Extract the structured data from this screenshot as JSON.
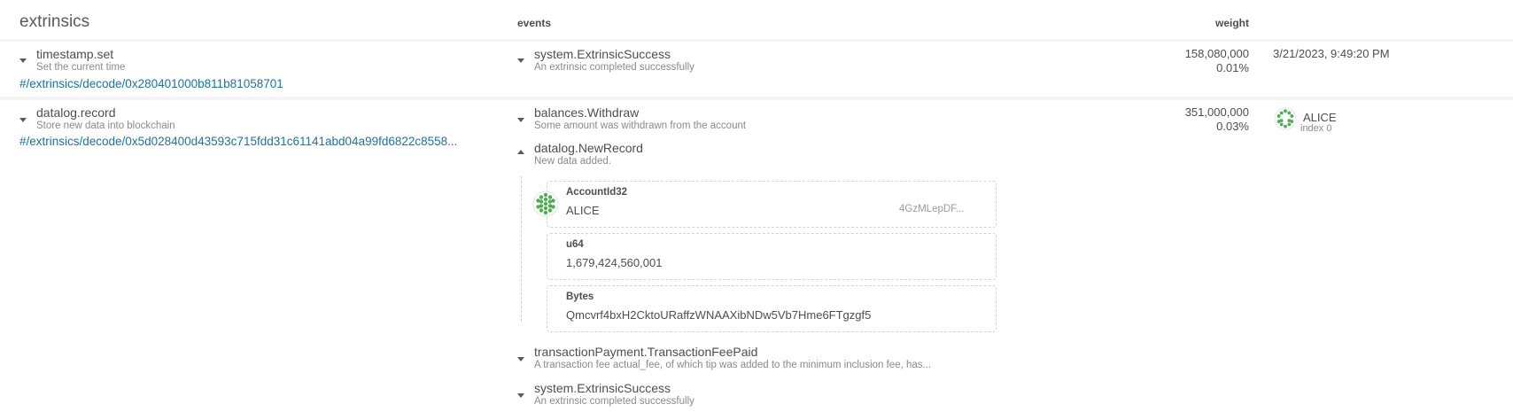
{
  "header": {
    "title": "extrinsics",
    "events_label": "events",
    "weight_label": "weight"
  },
  "rows": [
    {
      "call": {
        "name": "timestamp.set",
        "description": "Set the current time",
        "link": "#/extrinsics/decode/0x280401000b811b81058701"
      },
      "events": [
        {
          "name": "system.ExtrinsicSuccess",
          "description": "An extrinsic completed successfully"
        }
      ],
      "weight": {
        "value": "158,080,000",
        "percent": "0.01%"
      },
      "timestamp": "3/21/2023, 9:49:20 PM"
    },
    {
      "call": {
        "name": "datalog.record",
        "description": "Store new data into blockchain",
        "link": "#/extrinsics/decode/0x5d028400d43593c715fdd31c61141abd04a99fd6822c8558..."
      },
      "events": [
        {
          "name": "balances.Withdraw",
          "description": "Some amount was withdrawn from the account"
        },
        {
          "name": "datalog.NewRecord",
          "description": "New data added.",
          "params": [
            {
              "type": "AccountId32",
              "value": "ALICE",
              "address": "4GzMLepDF..."
            },
            {
              "type": "u64",
              "value": "1,679,424,560,001"
            },
            {
              "type": "Bytes",
              "value": "Qmcvrf4bxH2CktoURaffzWNAAXibNDw5Vb7Hme6FTgzgf5"
            }
          ]
        },
        {
          "name": "transactionPayment.TransactionFeePaid",
          "description": "A transaction fee actual_fee, of which tip was added to the minimum inclusion fee, has..."
        },
        {
          "name": "system.ExtrinsicSuccess",
          "description": "An extrinsic completed successfully"
        }
      ],
      "weight": {
        "value": "351,000,000",
        "percent": "0.03%"
      },
      "signer": {
        "name": "ALICE",
        "index": "index 0"
      }
    }
  ],
  "icons": {
    "expand": "chevron-down-icon",
    "collapse": "chevron-up-icon",
    "identicon": "identicon-icon"
  },
  "colors": {
    "link": "#1a73a8",
    "identicon": "#4caf50",
    "background": "#f5f4f3"
  }
}
